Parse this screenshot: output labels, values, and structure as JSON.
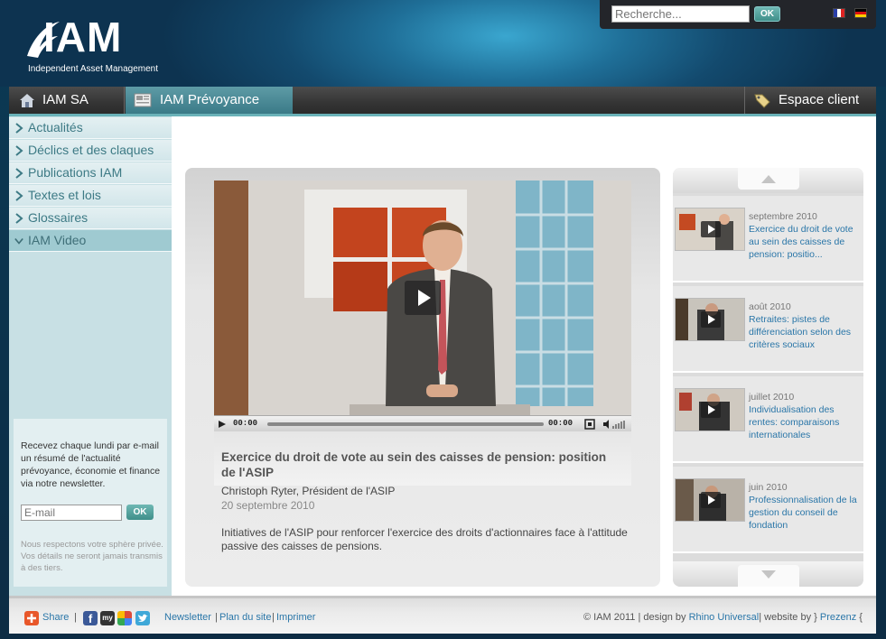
{
  "header": {
    "logo_text": "IAM",
    "logo_subtitle": "Independent Asset Management",
    "search_placeholder": "Recherche...",
    "search_button": "OK",
    "languages": [
      "fr",
      "de"
    ]
  },
  "nav": {
    "tabs": [
      {
        "label": "IAM SA",
        "icon": "house-icon"
      },
      {
        "label": "IAM Prévoyance",
        "icon": "newspaper-icon"
      }
    ],
    "client_label": "Espace client",
    "client_icon": "tag-icon"
  },
  "sidebar": {
    "items": [
      {
        "label": "Actualités"
      },
      {
        "label": "Déclics et des claques"
      },
      {
        "label": "Publications IAM"
      },
      {
        "label": "Textes et lois"
      },
      {
        "label": "Glossaires"
      },
      {
        "label": "IAM Video"
      }
    ],
    "active_item": "IAM Video"
  },
  "newsletter": {
    "text": "Recevez chaque lundi par e-mail un résumé de l'actualité prévoyance, économie et finance via notre newsletter.",
    "email_placeholder": "E-mail",
    "button": "OK",
    "privacy": "Nous respectons votre sphère privée. Vos détails ne seront jamais transmis à des tiers."
  },
  "video": {
    "time_current": "00:00",
    "time_total": "00:00",
    "title": "Exercice du droit de vote au sein des caisses de pension: position de l'ASIP",
    "author": "Christoph Ryter, Président de l'ASIP",
    "date": "20 septembre 2010",
    "description": "Initiatives de l'ASIP pour renforcer l'exercice des droits d'actionnaires face à l'attitude passive des caisses de pensions."
  },
  "playlist": {
    "items": [
      {
        "date": "septembre 2010",
        "title": "Exercice du droit de vote au sein des caisses de pension: positio..."
      },
      {
        "date": "août 2010",
        "title": "Retraites: pistes de différenciation selon des critères sociaux"
      },
      {
        "date": "juillet 2010",
        "title": "Individualisation des rentes: comparaisons internationales"
      },
      {
        "date": "juin 2010",
        "title": "Professionnalisation de la gestion du conseil de fondation"
      }
    ]
  },
  "footer": {
    "share": "Share",
    "sep": "|",
    "links": [
      "Newsletter",
      "Plan du site",
      "Imprimer"
    ],
    "copyright": "© IAM 2011 | design by",
    "designer": "Rhino Universal",
    "website_by": "| website by } ",
    "developer": "Prezenz",
    "brace": " {"
  },
  "colors": {
    "accent": "#3d7a85",
    "link": "#2a76a8",
    "nav_active": "#4a8c98"
  }
}
